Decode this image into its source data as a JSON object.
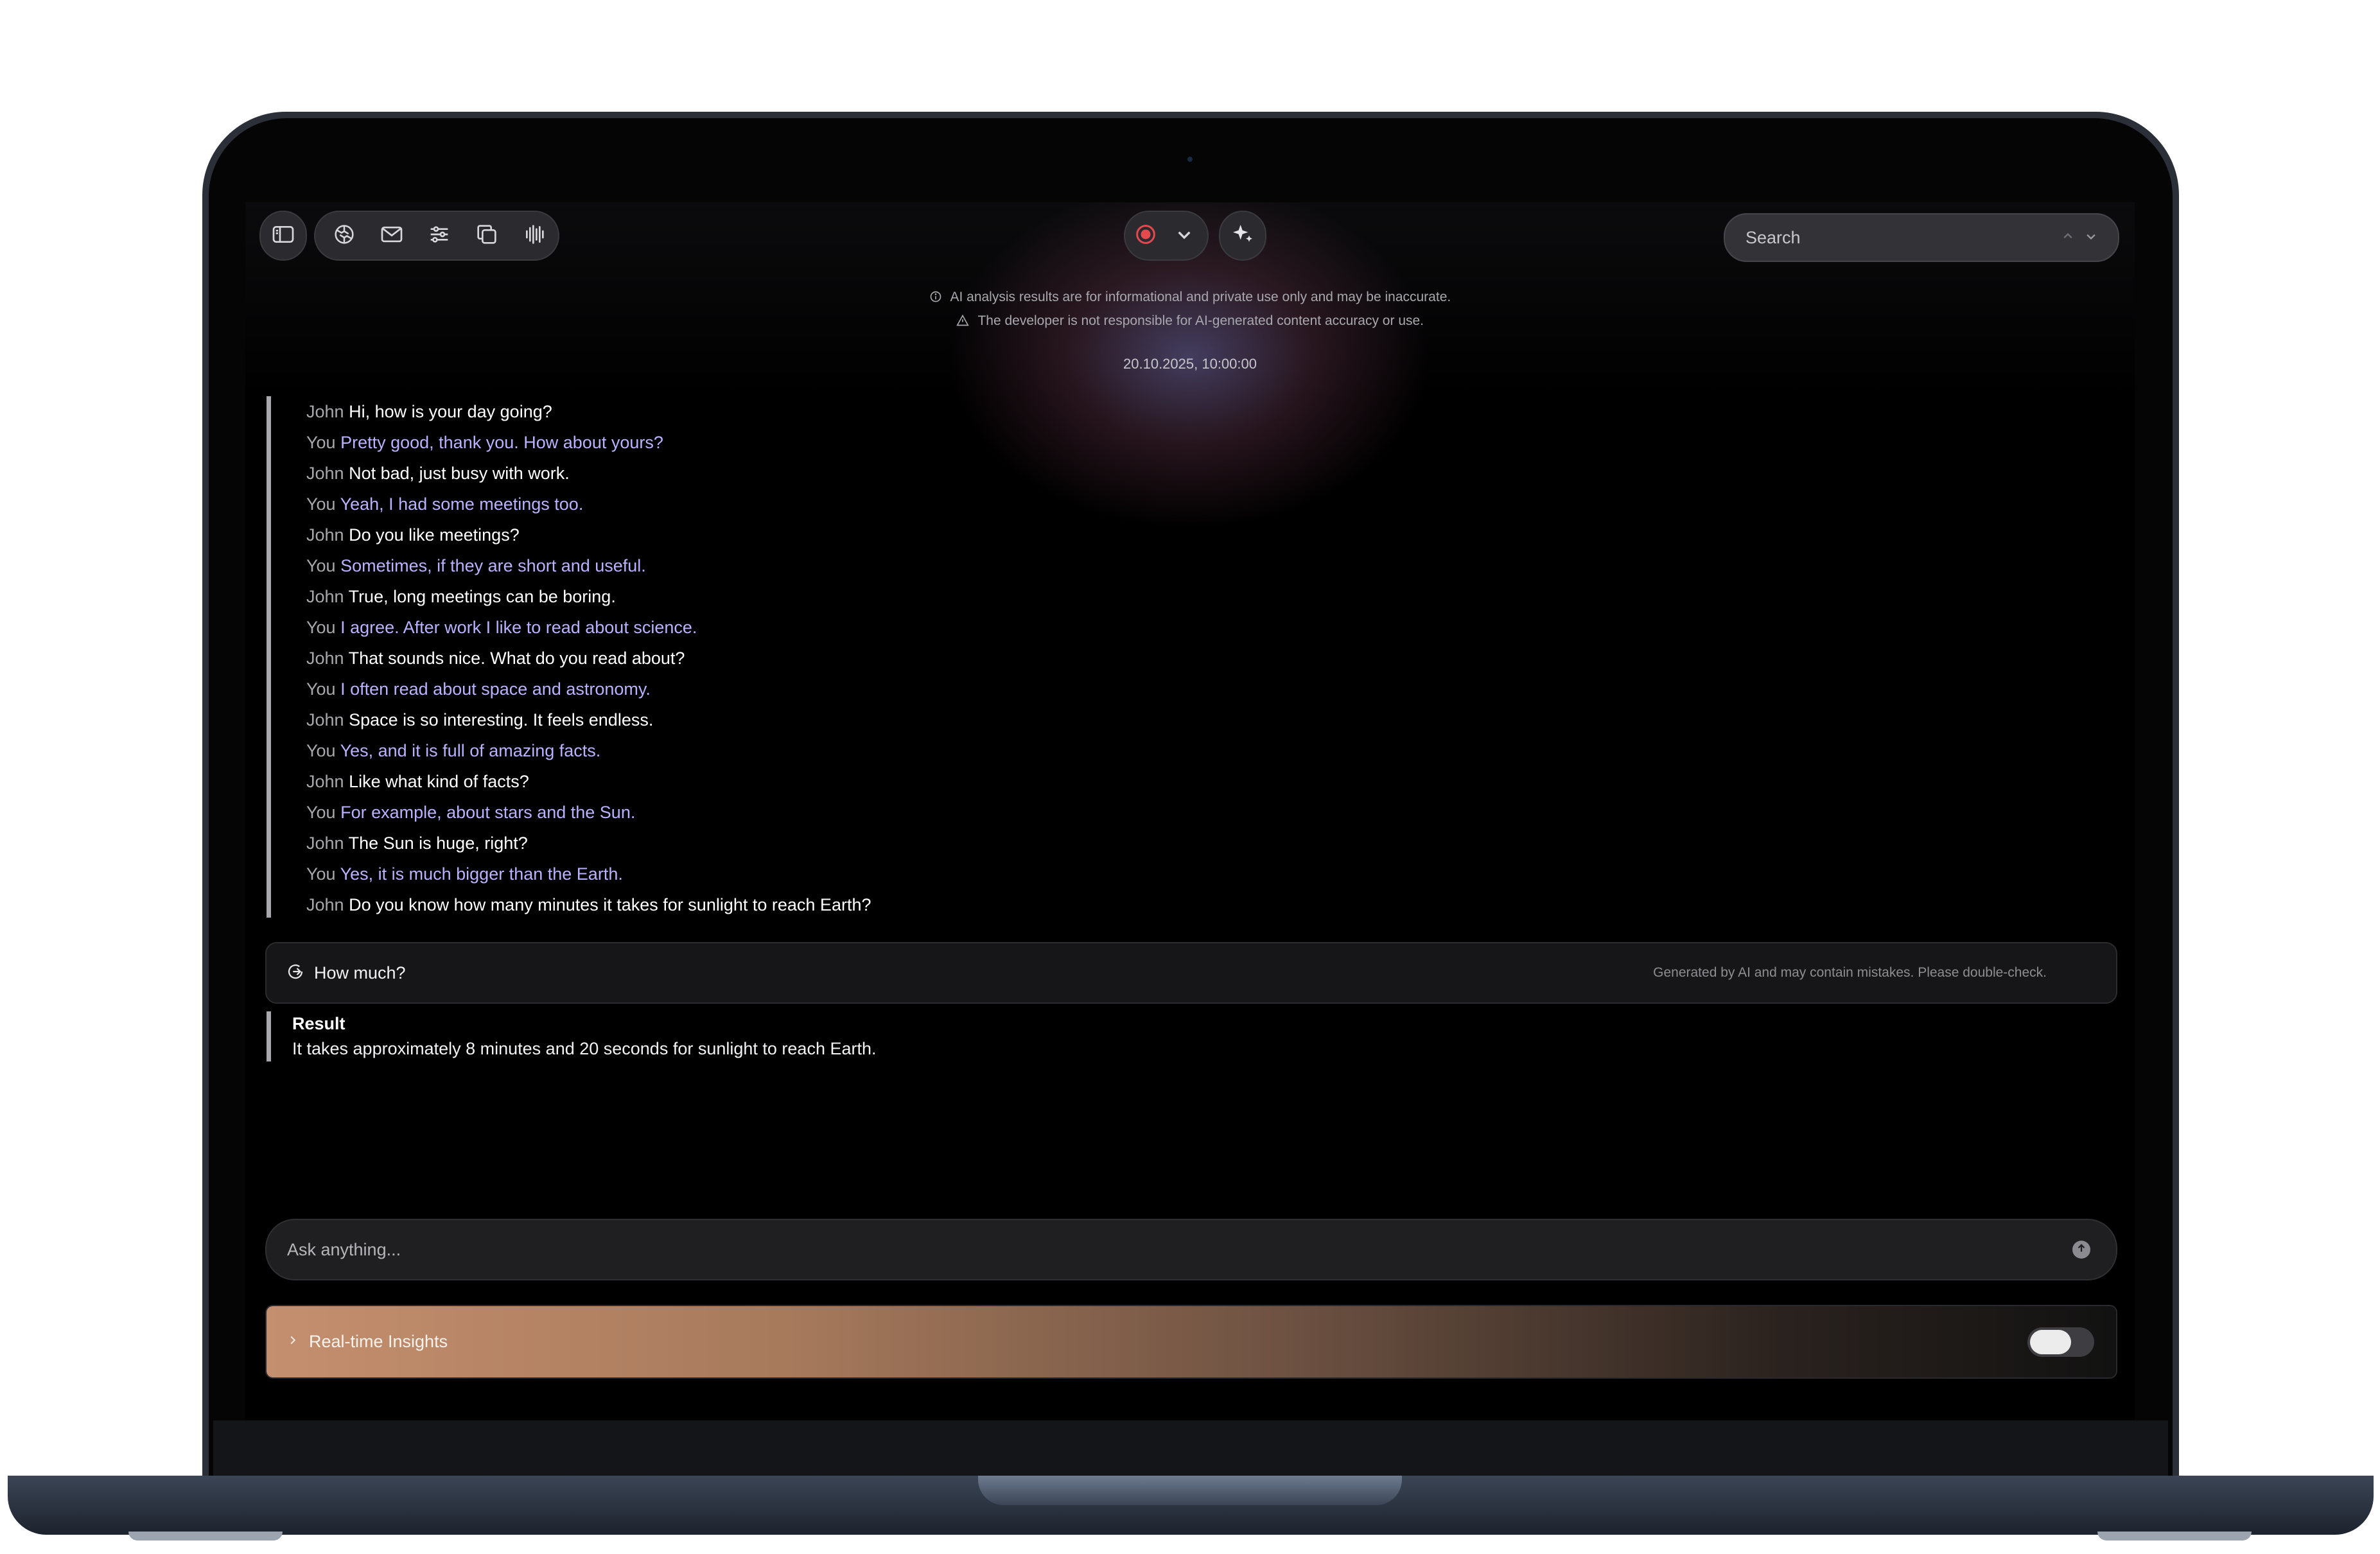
{
  "toolbar": {
    "icons": [
      "sidebar-icon",
      "openai-icon",
      "mail-icon",
      "sliders-icon",
      "copy-icon",
      "waveform-icon"
    ],
    "record_color": "#e5484d"
  },
  "search": {
    "placeholder": "Search"
  },
  "disclaimers": [
    "AI analysis results are for informational and private use only and may be inaccurate.",
    "The developer is not responsible for AI-generated content accuracy or use."
  ],
  "session": {
    "timestamp": "20.10.2025, 10:00:00"
  },
  "transcript": [
    {
      "speaker": "John",
      "text": "Hi, how is your day going?"
    },
    {
      "speaker": "You",
      "text": "Pretty good, thank you. How about yours?"
    },
    {
      "speaker": "John",
      "text": "Not bad, just busy with work."
    },
    {
      "speaker": "You",
      "text": "Yeah, I had some meetings too."
    },
    {
      "speaker": "John",
      "text": "Do you like meetings?"
    },
    {
      "speaker": "You",
      "text": "Sometimes, if they are short and useful."
    },
    {
      "speaker": "John",
      "text": "True, long meetings can be boring."
    },
    {
      "speaker": "You",
      "text": "I agree. After work I like to read about science."
    },
    {
      "speaker": "John",
      "text": "That sounds nice. What do you read about?"
    },
    {
      "speaker": "You",
      "text": "I often read about space and astronomy."
    },
    {
      "speaker": "John",
      "text": "Space is so interesting. It feels endless."
    },
    {
      "speaker": "You",
      "text": "Yes, and it is full of amazing facts."
    },
    {
      "speaker": "John",
      "text": "Like what kind of facts?"
    },
    {
      "speaker": "You",
      "text": "For example, about stars and the Sun."
    },
    {
      "speaker": "John",
      "text": "The Sun is huge, right?"
    },
    {
      "speaker": "You",
      "text": "Yes, it is much bigger than the Earth."
    },
    {
      "speaker": "John",
      "text": "Do you know how many minutes it takes for sunlight to reach Earth?"
    }
  ],
  "question": {
    "text": "How much?",
    "note": "Generated by AI and may contain mistakes. Please double-check."
  },
  "result": {
    "title": "Result",
    "text": "It takes approximately 8 minutes and 20 seconds for sunlight to reach Earth."
  },
  "ask": {
    "placeholder": "Ask anything..."
  },
  "insights": {
    "label": "Real-time Insights",
    "enabled": false
  }
}
